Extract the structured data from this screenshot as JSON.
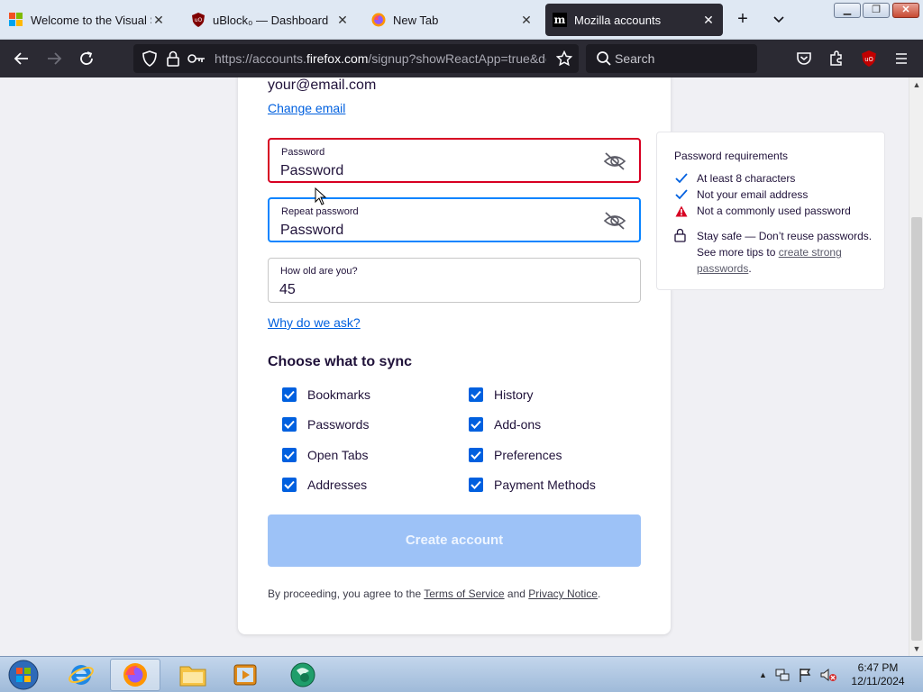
{
  "browser": {
    "tabs": [
      {
        "title": "Welcome to the Visual Stu",
        "icon": "windows-logo-icon",
        "active": false
      },
      {
        "title": "uBlock₀ — Dashboard",
        "icon": "ublock-icon",
        "active": false
      },
      {
        "title": "New Tab",
        "icon": "firefox-icon",
        "active": false
      },
      {
        "title": "Mozilla accounts",
        "icon": "mozilla-m-icon",
        "active": true
      }
    ],
    "close_glyph": "✕",
    "new_tab_glyph": "+",
    "url": {
      "prefix": "https://accounts.",
      "domain": "firefox.com",
      "suffix": "/signup?showReactApp=true&de"
    },
    "search_placeholder": "Search"
  },
  "page": {
    "email": "your@email.com",
    "change_email_label": "Change email",
    "password_field": {
      "label": "Password",
      "value": "Password",
      "state": "error"
    },
    "repeat_password_field": {
      "label": "Repeat password",
      "value": "Password",
      "state": "focused"
    },
    "age_field": {
      "label": "How old are you?",
      "value": "45"
    },
    "why_link": "Why do we ask?",
    "sync_title": "Choose what to sync",
    "sync_options": [
      {
        "label": "Bookmarks",
        "checked": true
      },
      {
        "label": "History",
        "checked": true
      },
      {
        "label": "Passwords",
        "checked": true
      },
      {
        "label": "Add-ons",
        "checked": true
      },
      {
        "label": "Open Tabs",
        "checked": true
      },
      {
        "label": "Preferences",
        "checked": true
      },
      {
        "label": "Addresses",
        "checked": true
      },
      {
        "label": "Payment Methods",
        "checked": true
      }
    ],
    "create_button": "Create account",
    "legal": {
      "prefix": "By proceeding, you agree to the ",
      "terms": "Terms of Service",
      "and": " and ",
      "privacy": "Privacy Notice",
      "suffix": "."
    }
  },
  "requirements": {
    "title": "Password requirements",
    "items": [
      {
        "text": "At least 8 characters",
        "status": "met"
      },
      {
        "text": "Not your email address",
        "status": "met"
      },
      {
        "text": "Not a commonly used password",
        "status": "error"
      }
    ],
    "tip_line1": "Stay safe — Don’t reuse passwords.",
    "tip_line2_prefix": "See more tips to ",
    "tip_link_1": "create strong",
    "tip_link_2": "passwords",
    "tip_suffix": "."
  },
  "taskbar": {
    "time": "6:47 PM",
    "date": "12/11/2024"
  },
  "colors": {
    "accent": "#0060df",
    "error": "#d70022",
    "focus": "#0a84ff",
    "button_disabled": "#9dc2f7"
  }
}
